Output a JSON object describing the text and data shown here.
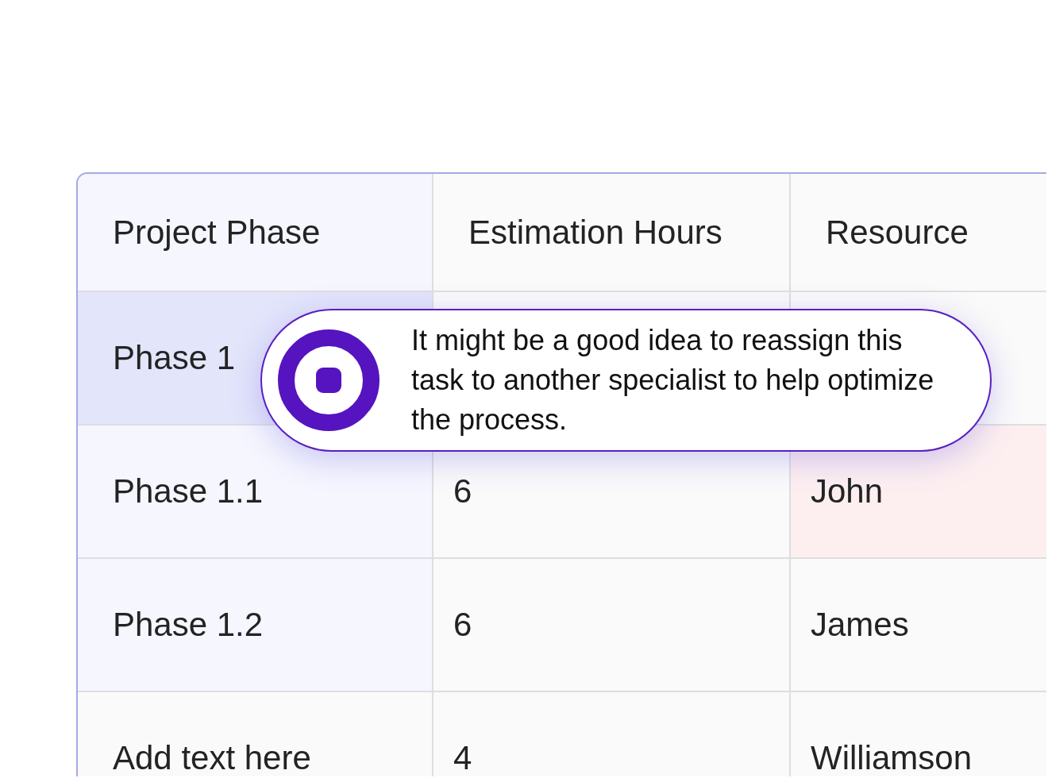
{
  "table": {
    "columns": [
      {
        "label": "Project Phase",
        "color": "#f5f6fe"
      },
      {
        "label": "Estimation Hours",
        "color": "#fafafa"
      },
      {
        "label": "Resource",
        "color": "#fafafa"
      }
    ],
    "rows": [
      {
        "cells": [
          {
            "text": "Phase 1",
            "color": "#e3e5fb"
          },
          {
            "color": "#fafafa"
          },
          {
            "color": "#fafafa"
          }
        ]
      },
      {
        "cells": [
          {
            "text": "Phase 1.1",
            "color": "#f5f6fe"
          },
          {
            "text": "6",
            "color": "#fafafa"
          },
          {
            "text": "John",
            "color": "#fdeff0"
          }
        ]
      },
      {
        "cells": [
          {
            "text": "Phase 1.2",
            "color": "#f5f6fe"
          },
          {
            "text": "6",
            "color": "#fafafa"
          },
          {
            "text": "James",
            "color": "#fafafa"
          }
        ]
      },
      {
        "cells": [
          {
            "text": "Add text here",
            "color": "#fafafa"
          },
          {
            "text": "4",
            "color": "#fafafa"
          },
          {
            "text": "Williamson",
            "color": "#fafafa"
          }
        ]
      }
    ]
  },
  "tooltip": {
    "text": "It might be a good idea to reassign this task to another specialist to help optimize the process."
  }
}
